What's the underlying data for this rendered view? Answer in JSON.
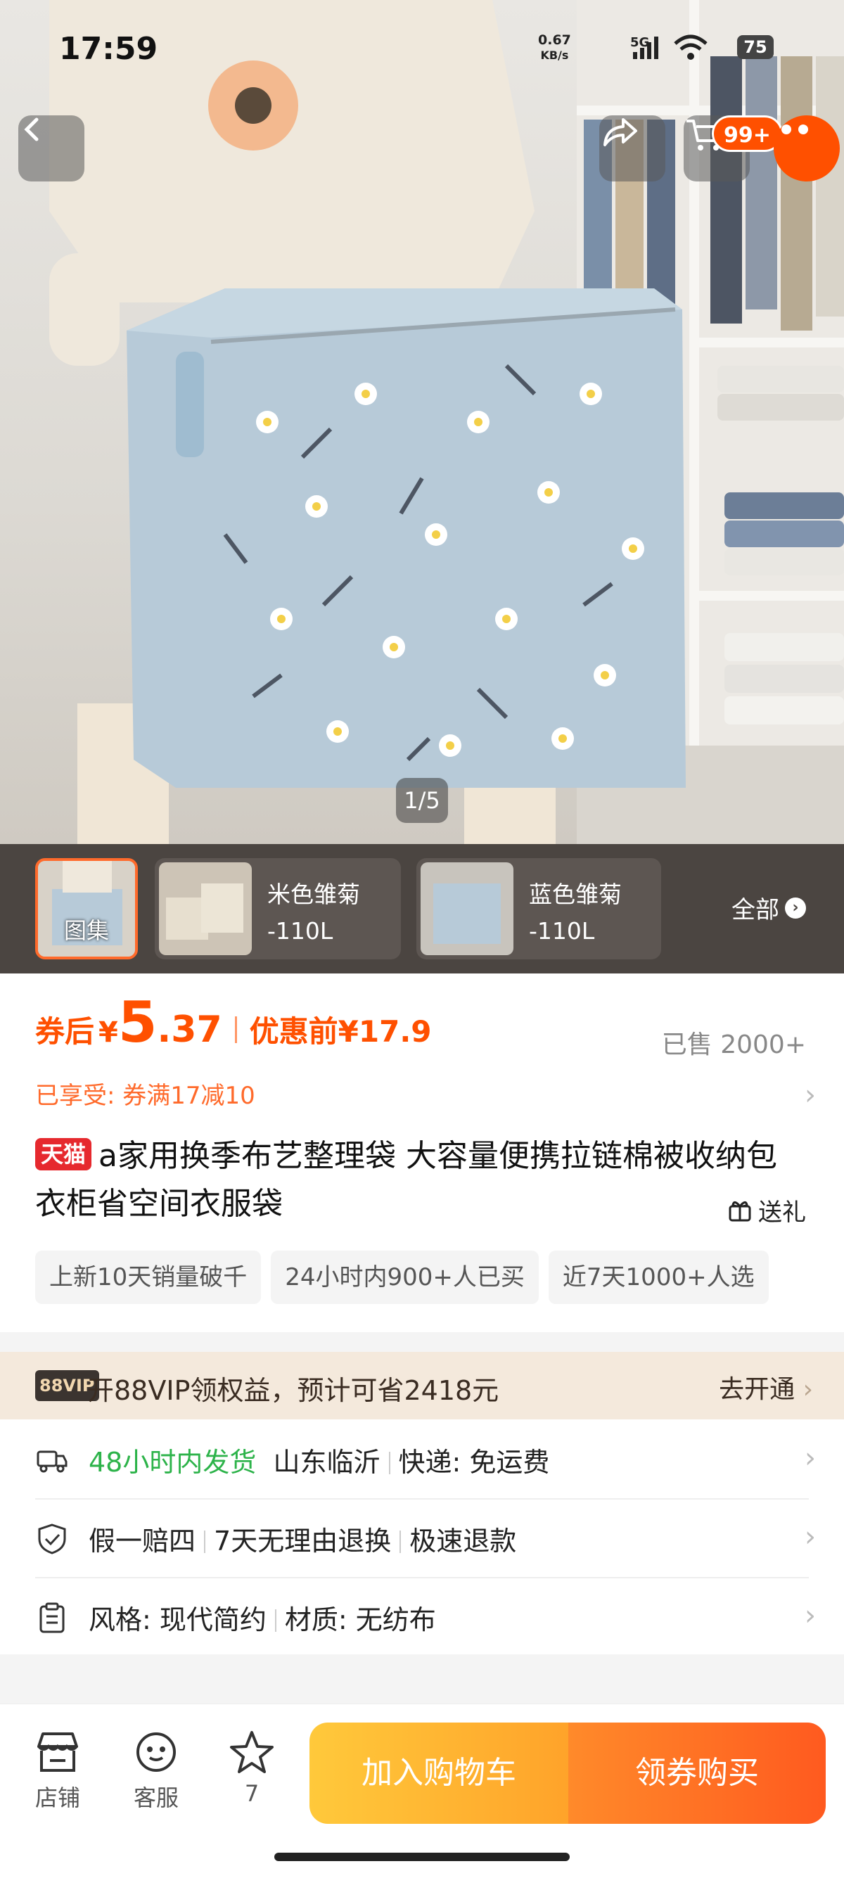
{
  "status_bar": {
    "time": "17:59",
    "net_speed": "0.67",
    "net_unit": "KB/s",
    "network": "5G",
    "battery": "75"
  },
  "header": {
    "cart_badge": "99+"
  },
  "gallery": {
    "page_indicator": "1/5",
    "main_thumb_label": "图集",
    "variants": [
      {
        "name": "米色雏菊",
        "size": "-110L"
      },
      {
        "name": "蓝色雏菊",
        "size": "-110L"
      }
    ],
    "all_label": "全部"
  },
  "price": {
    "prefix": "券后",
    "currency": "¥",
    "integer": "5",
    "decimal": ".37",
    "before_label": "优惠前¥17.9",
    "sold": "已售 2000+",
    "enjoyed": "已享受: 券满17减10"
  },
  "product": {
    "platform_badge": "天猫",
    "title": "a家用换季布艺整理袋 大容量便携拉链棉被收纳包 衣柜省空间衣服袋",
    "gift_label": "送礼",
    "tags": [
      "上新10天销量破千",
      "24小时内900+人已买",
      "近7天1000+人选"
    ]
  },
  "vip": {
    "logo": "88VIP",
    "text": "开88VIP领权益，预计可省2418元",
    "cta": "去开通"
  },
  "shipping": {
    "time": "48小时内发货",
    "origin": "山东临沂",
    "delivery": "快递:  免运费"
  },
  "guarantee": {
    "items": [
      "假一赔四",
      "7天无理由退换",
      "极速退款"
    ]
  },
  "specs": {
    "style": "风格: 现代简约",
    "material": "材质: 无纺布"
  },
  "bottom_bar": {
    "shop": "店铺",
    "service": "客服",
    "favorites": "7",
    "add_cart": "加入购物车",
    "buy": "领券购买"
  },
  "colors": {
    "accent": "#ff5000",
    "tmall_red": "#e6292e",
    "green": "#2db34a"
  }
}
